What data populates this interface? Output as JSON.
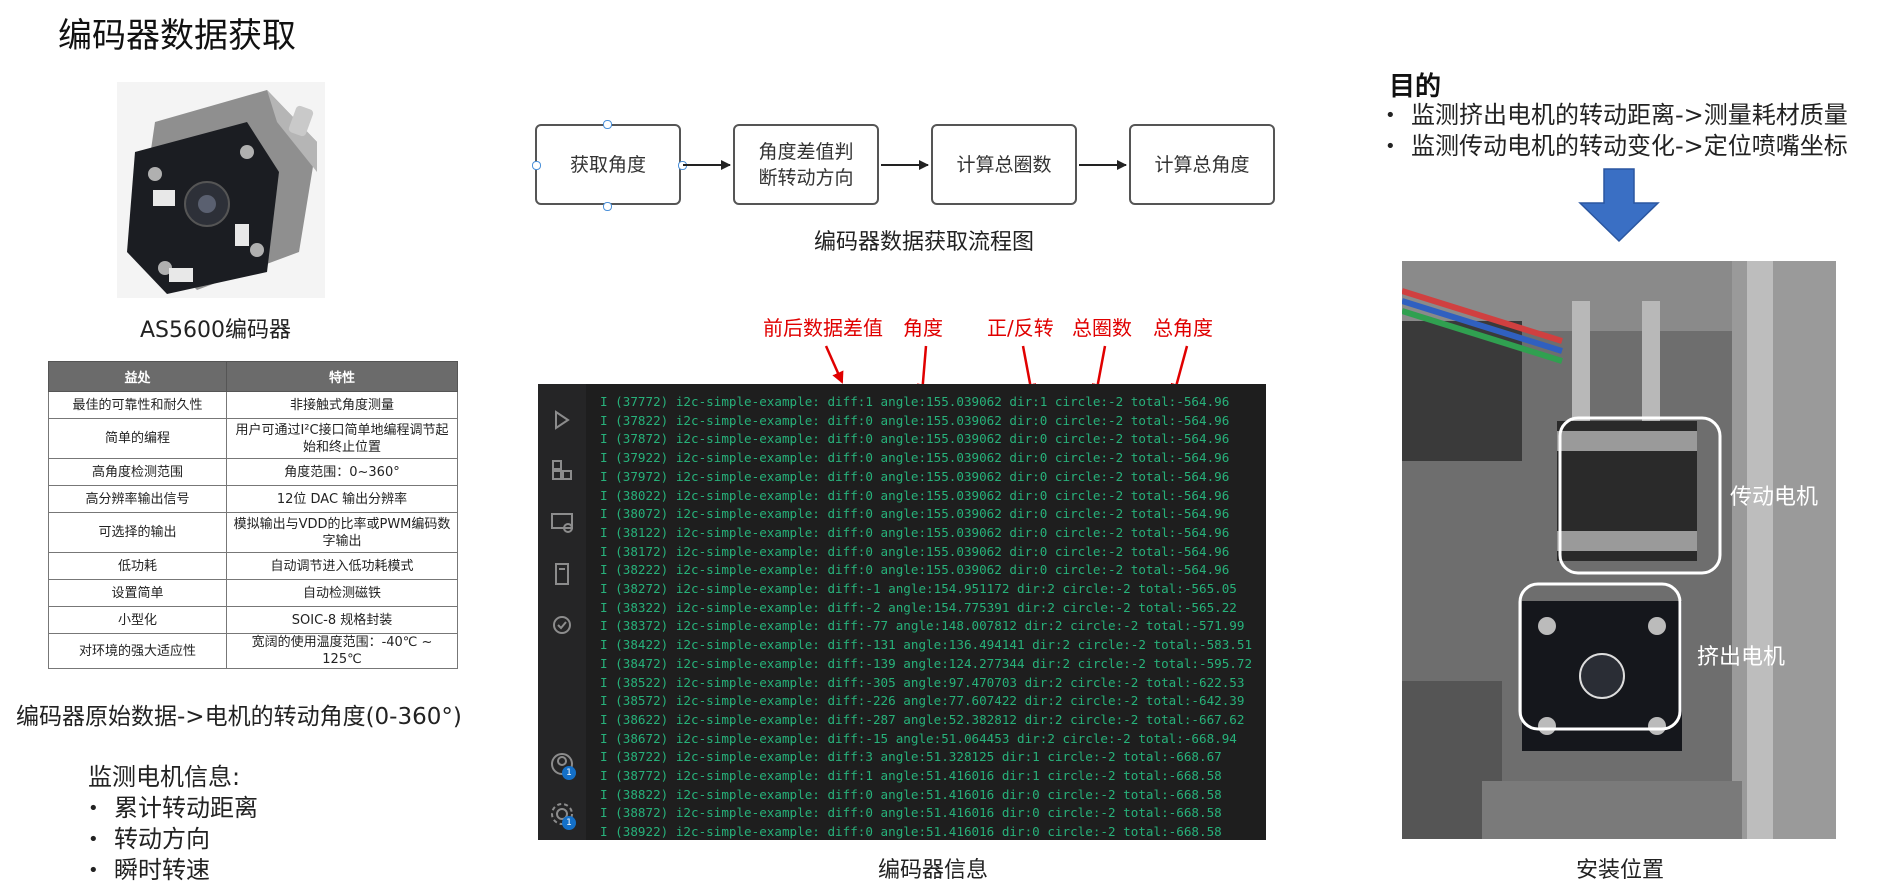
{
  "title": "编码器数据获取",
  "motor": {
    "caption": "AS5600编码器"
  },
  "table": {
    "headers": [
      "益处",
      "特性"
    ],
    "rows": [
      [
        "最佳的可靠性和耐久性",
        "非接触式角度测量"
      ],
      [
        "简单的编程",
        "用户可通过I²C接口简单地编程调节起始和终止位置"
      ],
      [
        "高角度检测范围",
        "角度范围：0~360°"
      ],
      [
        "高分辨率输出信号",
        "12位 DAC 输出分辨率"
      ],
      [
        "可选择的输出",
        "模拟输出与VDD的比率或PWM编码数字输出"
      ],
      [
        "低功耗",
        "自动调节进入低功耗模式"
      ],
      [
        "设置简单",
        "自动检测磁铁"
      ],
      [
        "小型化",
        "SOIC-8 规格封装"
      ],
      [
        "对环境的强大适应性",
        "宽阔的使用温度范围：-40℃ ~ 125℃"
      ]
    ]
  },
  "raw_note": "编码器原始数据->电机的转动角度(0-360°)",
  "monitor": {
    "heading": "监测电机信息:",
    "items": [
      "累计转动距离",
      "转动方向",
      "瞬时转速"
    ]
  },
  "flow": {
    "steps": [
      "获取角度",
      "角度差值判断转动方向",
      "计算总圈数",
      "计算总角度"
    ],
    "caption": "编码器数据获取流程图"
  },
  "annotations": [
    "前后数据差值",
    "角度",
    "正/反转",
    "总圈数",
    "总角度"
  ],
  "terminal": {
    "caption": "编码器信息",
    "badges": [
      "1",
      "1"
    ],
    "lines": [
      "I (37772) i2c-simple-example: diff:1 angle:155.039062 dir:1 circle:-2 total:-564.96",
      "I (37822) i2c-simple-example: diff:0 angle:155.039062 dir:0 circle:-2 total:-564.96",
      "I (37872) i2c-simple-example: diff:0 angle:155.039062 dir:0 circle:-2 total:-564.96",
      "I (37922) i2c-simple-example: diff:0 angle:155.039062 dir:0 circle:-2 total:-564.96",
      "I (37972) i2c-simple-example: diff:0 angle:155.039062 dir:0 circle:-2 total:-564.96",
      "I (38022) i2c-simple-example: diff:0 angle:155.039062 dir:0 circle:-2 total:-564.96",
      "I (38072) i2c-simple-example: diff:0 angle:155.039062 dir:0 circle:-2 total:-564.96",
      "I (38122) i2c-simple-example: diff:0 angle:155.039062 dir:0 circle:-2 total:-564.96",
      "I (38172) i2c-simple-example: diff:0 angle:155.039062 dir:0 circle:-2 total:-564.96",
      "I (38222) i2c-simple-example: diff:0 angle:155.039062 dir:0 circle:-2 total:-564.96",
      "I (38272) i2c-simple-example: diff:-1 angle:154.951172 dir:2 circle:-2 total:-565.05",
      "I (38322) i2c-simple-example: diff:-2 angle:154.775391 dir:2 circle:-2 total:-565.22",
      "I (38372) i2c-simple-example: diff:-77 angle:148.007812 dir:2 circle:-2 total:-571.99",
      "I (38422) i2c-simple-example: diff:-131 angle:136.494141 dir:2 circle:-2 total:-583.51",
      "I (38472) i2c-simple-example: diff:-139 angle:124.277344 dir:2 circle:-2 total:-595.72",
      "I (38522) i2c-simple-example: diff:-305 angle:97.470703 dir:2 circle:-2 total:-622.53",
      "I (38572) i2c-simple-example: diff:-226 angle:77.607422 dir:2 circle:-2 total:-642.39",
      "I (38622) i2c-simple-example: diff:-287 angle:52.382812 dir:2 circle:-2 total:-667.62",
      "I (38672) i2c-simple-example: diff:-15 angle:51.064453 dir:2 circle:-2 total:-668.94",
      "I (38722) i2c-simple-example: diff:3 angle:51.328125 dir:1 circle:-2 total:-668.67",
      "I (38772) i2c-simple-example: diff:1 angle:51.416016 dir:1 circle:-2 total:-668.58",
      "I (38822) i2c-simple-example: diff:0 angle:51.416016 dir:0 circle:-2 total:-668.58",
      "I (38872) i2c-simple-example: diff:0 angle:51.416016 dir:0 circle:-2 total:-668.58",
      "I (38922) i2c-simple-example: diff:0 angle:51.416016 dir:0 circle:-2 total:-668.58"
    ]
  },
  "purpose": {
    "heading": "目的",
    "items": [
      "监测挤出电机的转动距离->测量耗材质量",
      "监测传动电机的转动变化->定位喷嘴坐标"
    ]
  },
  "install": {
    "caption": "安装位置",
    "labels": [
      "传动电机",
      "挤出电机"
    ]
  },
  "colors": {
    "flow_arrow": "#222222",
    "annotation": "#e00000",
    "down_arrow": "#3a6fc4",
    "terminal_text": "#27b17a"
  }
}
